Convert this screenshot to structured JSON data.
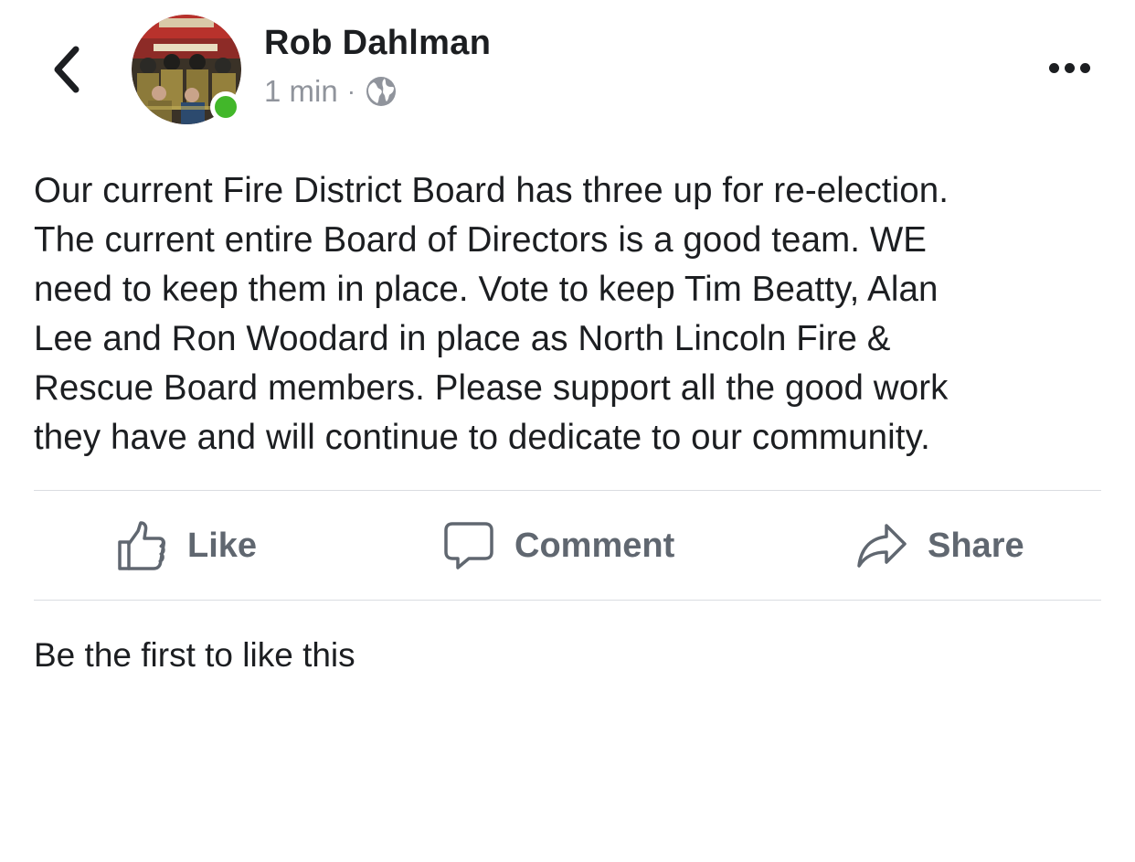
{
  "header": {
    "back_icon": "chevron-left-icon",
    "author_name": "Rob Dahlman",
    "timestamp": "1 min",
    "separator": "·",
    "privacy_icon": "globe-icon",
    "more_icon": "more-horizontal-icon",
    "online_status_color": "#42b72a"
  },
  "post": {
    "lines": [
      "Our current Fire District Board has three up for re-election.",
      "The current entire Board of Directors is a good team. WE",
      "need to keep them in place. Vote to keep Tim Beatty, Alan",
      "Lee and Ron Woodard in place as North Lincoln Fire &",
      "Rescue Board members. Please support all the good work",
      "they have and will continue to dedicate to our community."
    ]
  },
  "actions": {
    "like_label": "Like",
    "comment_label": "Comment",
    "share_label": "Share",
    "icon_color": "#606770"
  },
  "likes_summary": "Be the first to like this"
}
